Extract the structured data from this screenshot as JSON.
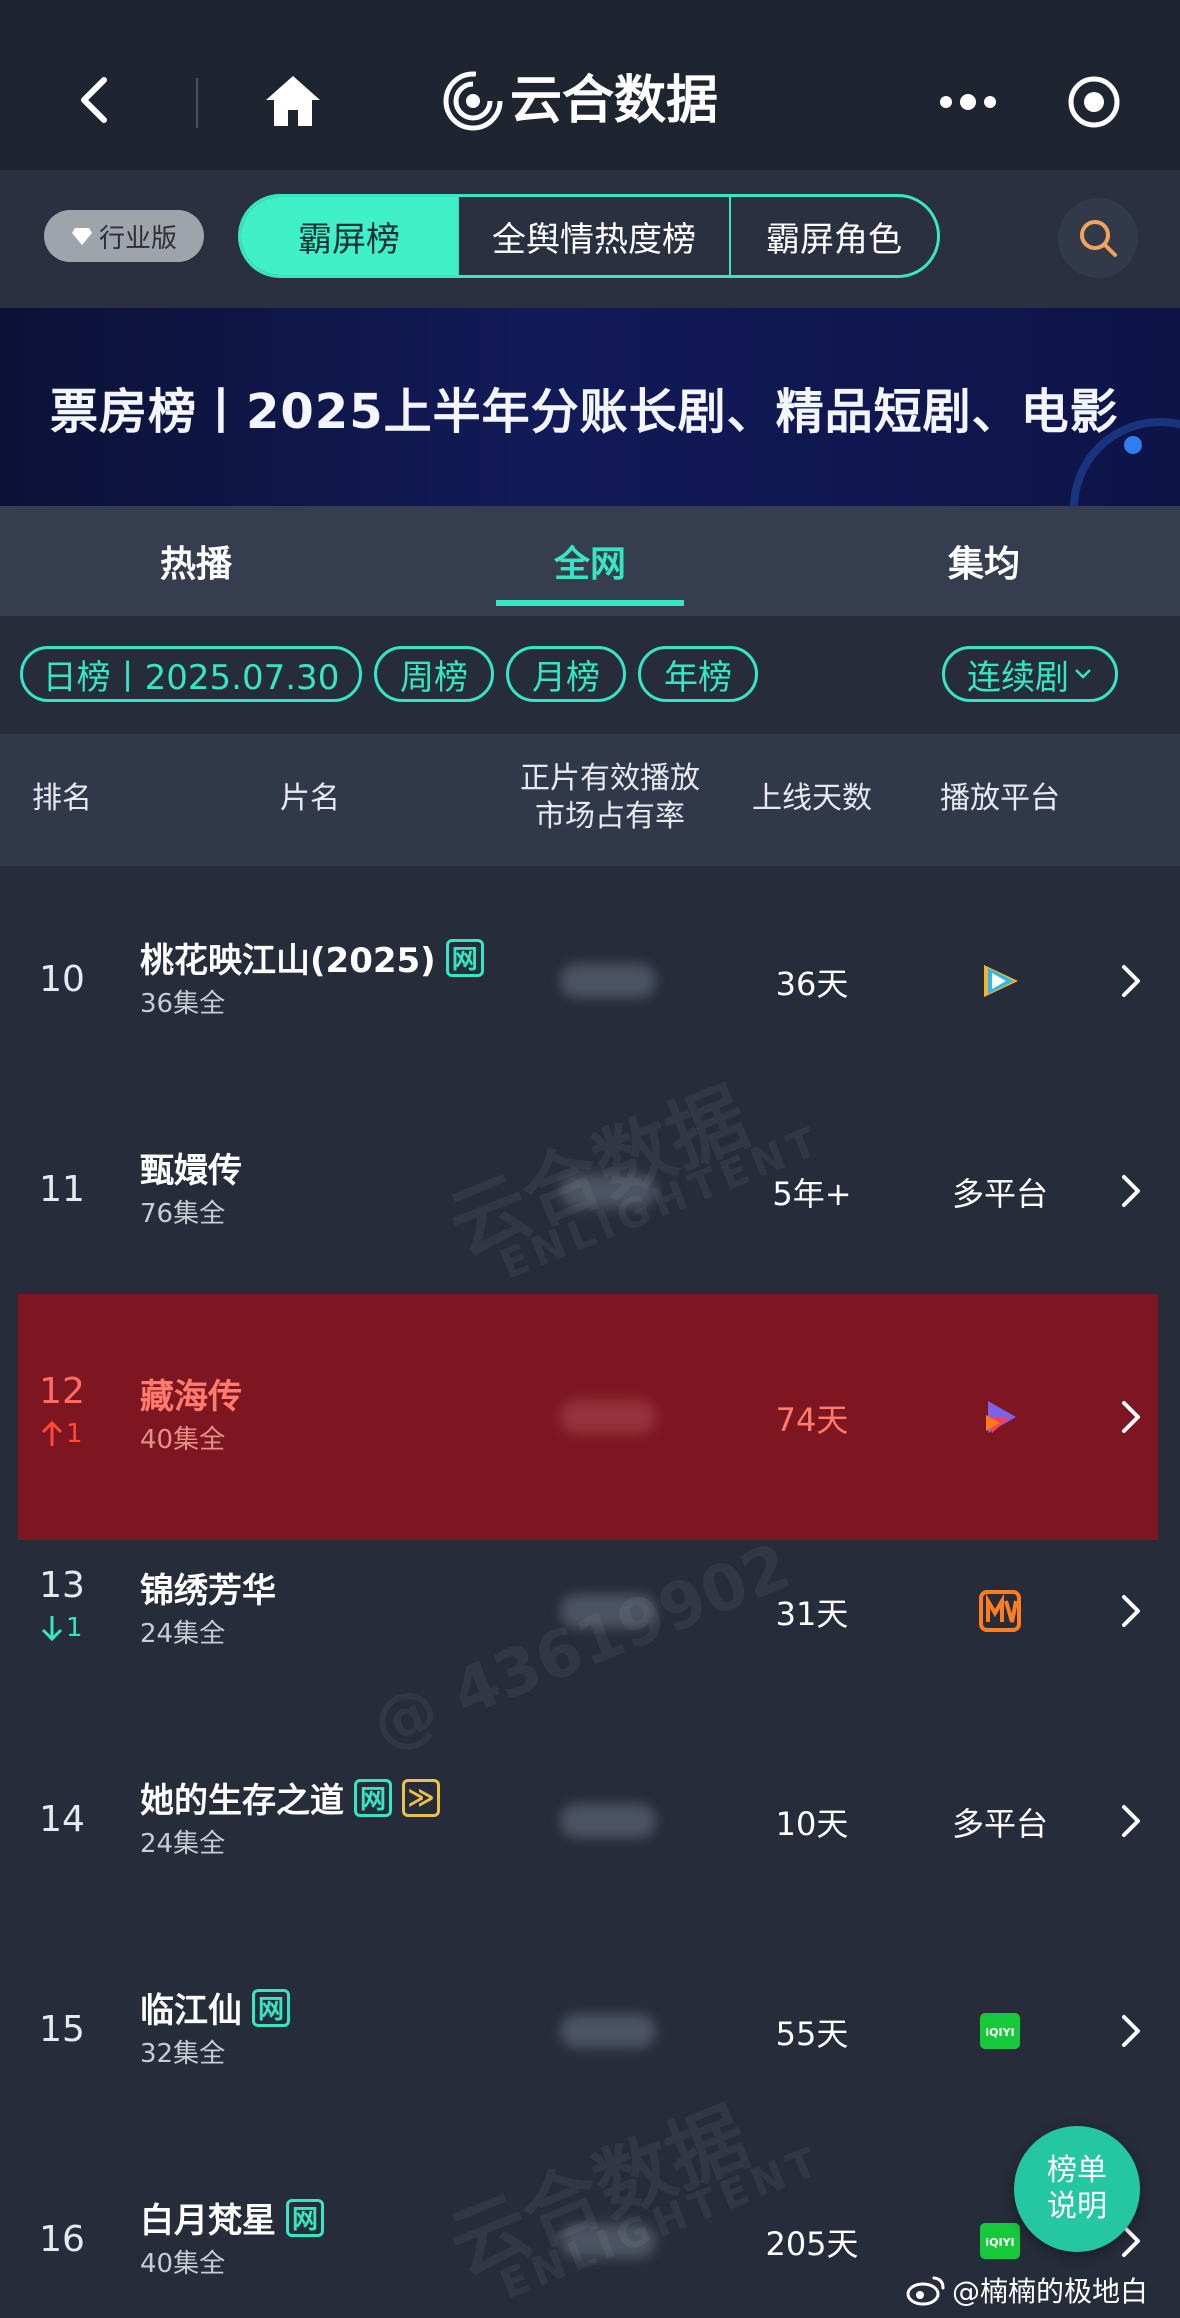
{
  "app": {
    "title": "云合数据"
  },
  "segments": {
    "edition_badge": "行业版",
    "tabs": [
      "霸屏榜",
      "全舆情热度榜",
      "霸屏角色"
    ]
  },
  "banner": {
    "text": "票房榜丨2025上半年分账长剧、精品短剧、电影"
  },
  "main_tabs": [
    "热播",
    "全网",
    "集均"
  ],
  "filters": {
    "daily": "日榜丨2025.07.30",
    "weekly": "周榜",
    "monthly": "月榜",
    "yearly": "年榜",
    "type_select": "连续剧"
  },
  "table": {
    "headers": {
      "rank": "排名",
      "title": "片名",
      "share_line1": "正片有效播放",
      "share_line2": "市场占有率",
      "days": "上线天数",
      "platform": "播放平台"
    },
    "rows": [
      {
        "rank": "10",
        "title": "桃花映江山(2025)",
        "tags": [
          "网"
        ],
        "episodes": "36集全",
        "days": "36天",
        "platform_icon": "tencent-video-icon",
        "platform_text": "",
        "trend": ""
      },
      {
        "rank": "11",
        "title": "甄嬛传",
        "tags": [],
        "episodes": "76集全",
        "days": "5年+",
        "platform_icon": "",
        "platform_text": "多平台",
        "trend": ""
      },
      {
        "rank": "12",
        "title": "藏海传",
        "tags": [],
        "episodes": "40集全",
        "days": "74天",
        "platform_icon": "youku-icon",
        "platform_text": "",
        "trend": "1",
        "trend_dir": "up",
        "highlight": true
      },
      {
        "rank": "13",
        "title": "锦绣芳华",
        "tags": [],
        "episodes": "24集全",
        "days": "31天",
        "platform_icon": "mango-tv-icon",
        "platform_text": "",
        "trend": "1",
        "trend_dir": "down"
      },
      {
        "rank": "14",
        "title": "她的生存之道",
        "tags": [
          "网",
          "≫"
        ],
        "episodes": "24集全",
        "days": "10天",
        "platform_icon": "",
        "platform_text": "多平台",
        "trend": ""
      },
      {
        "rank": "15",
        "title": "临江仙",
        "tags": [
          "网"
        ],
        "episodes": "32集全",
        "days": "55天",
        "platform_icon": "iqiyi-icon",
        "platform_text": "",
        "trend": ""
      },
      {
        "rank": "16",
        "title": "白月梵星",
        "tags": [
          "网"
        ],
        "episodes": "40集全",
        "days": "205天",
        "platform_icon": "iqiyi-icon",
        "platform_text": "",
        "trend": ""
      }
    ]
  },
  "watermark": {
    "brand": "云合数据",
    "brand_en": "ENLIGHTENT",
    "code": "@ 43619902"
  },
  "help_button": {
    "line1": "榜单",
    "line2": "说明"
  },
  "credit": {
    "text": "@楠楠的极地白"
  },
  "colors": {
    "accent": "#35e6c4",
    "highlight_row": "#7d1620",
    "up": "#ff4a3a",
    "down": "#35e6c4"
  }
}
